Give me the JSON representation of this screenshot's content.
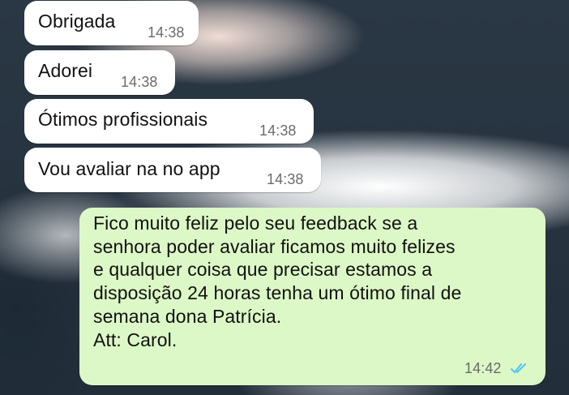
{
  "messages_in": [
    {
      "text": "Obrigada",
      "time": "14:38"
    },
    {
      "text": "Adorei",
      "time": "14:38"
    },
    {
      "text": "Ótimos profissionais",
      "time": "14:38"
    },
    {
      "text": "Vou avaliar na no app",
      "time": "14:38"
    }
  ],
  "message_out": {
    "text": "Fico muito feliz pelo seu feedback se a\nsenhora poder avaliar ficamos muito felizes\ne qualquer coisa que precisar estamos a\ndisposição 24 horas tenha um ótimo final de\nsemana dona Patrícia.\nAtt: Carol.",
    "time": "14:42",
    "status_icon": "double-check-read-icon"
  },
  "colors": {
    "incoming_bubble": "#ffffff",
    "outgoing_bubble": "#dcf8c6",
    "read_ticks": "#4fc3f7"
  }
}
